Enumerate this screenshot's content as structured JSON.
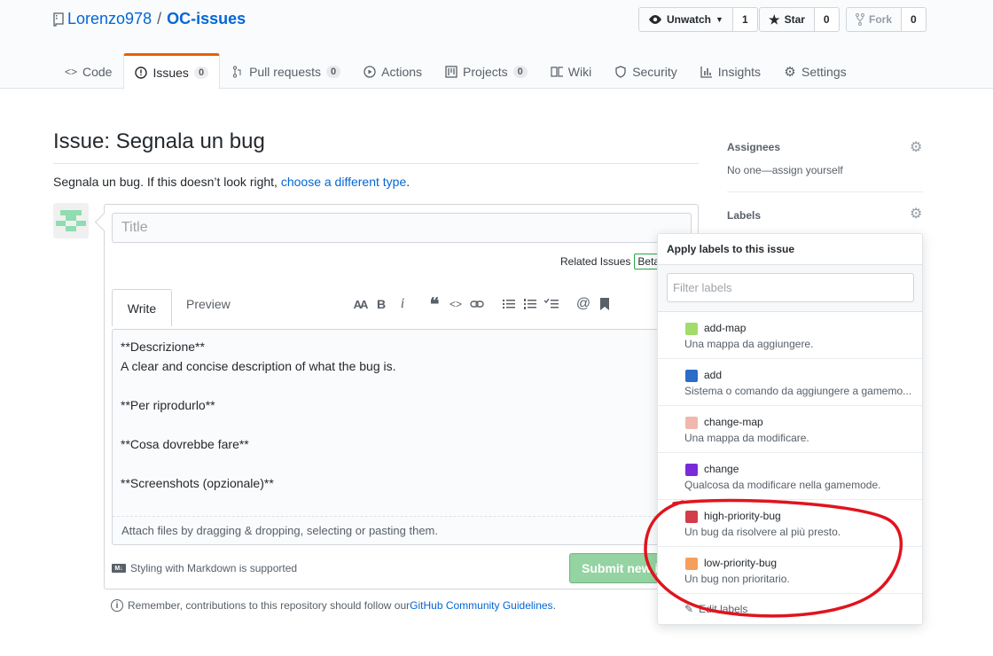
{
  "repo": {
    "owner": "Lorenzo978",
    "separator": "/",
    "name": "OC-issues",
    "watch_label": "Unwatch",
    "watch_count": "1",
    "star_label": "Star",
    "star_count": "0",
    "fork_label": "Fork",
    "fork_count": "0"
  },
  "tabs": [
    {
      "label": "Code",
      "icon": "code-icon"
    },
    {
      "label": "Issues",
      "icon": "issue-icon",
      "count": "0"
    },
    {
      "label": "Pull requests",
      "icon": "pull-request-icon",
      "count": "0"
    },
    {
      "label": "Actions",
      "icon": "play-icon"
    },
    {
      "label": "Projects",
      "icon": "project-icon",
      "count": "0"
    },
    {
      "label": "Wiki",
      "icon": "book-icon"
    },
    {
      "label": "Security",
      "icon": "shield-icon"
    },
    {
      "label": "Insights",
      "icon": "graph-icon"
    },
    {
      "label": "Settings",
      "icon": "gear-icon"
    }
  ],
  "issue": {
    "heading": "Issue: Segnala un bug",
    "subtitle_prefix": "Segnala un bug. If this doesn’t look right, ",
    "subtitle_link": "choose a different type",
    "subtitle_suffix": ".",
    "title_placeholder": "Title",
    "related_label": "Related Issues",
    "beta_label": "Beta",
    "write_tab": "Write",
    "preview_tab": "Preview",
    "toolbar_heading": "AA",
    "toolbar_bold": "B",
    "toolbar_italic": "i",
    "toolbar_mention": "@",
    "body": "**Descrizione**\nA clear and concise description of what the bug is.\n\n**Per riprodurlo**\n\n**Cosa dovrebbe fare**\n\n**Screenshots (opzionale)**",
    "attach_text": "Attach files by dragging & dropping, selecting or pasting them.",
    "markdown_note": "Styling with Markdown is supported",
    "submit_label": "Submit new i",
    "guidelines_prefix": "Remember, contributions to this repository should follow our ",
    "guidelines_link": "GitHub Community Guidelines",
    "guidelines_suffix": "."
  },
  "sidebar": {
    "assignees_heading": "Assignees",
    "assignees_value": "No one—assign yourself",
    "labels_heading": "Labels"
  },
  "labels_dropdown": {
    "heading": "Apply labels to this issue",
    "filter_placeholder": "Filter labels",
    "items": [
      {
        "name": "add-map",
        "description": "Una mappa da aggiungere.",
        "color": "#a2dc6b"
      },
      {
        "name": "add",
        "description": "Sistema o comando da aggiungere a gamemo...",
        "color": "#2a6cc7"
      },
      {
        "name": "change-map",
        "description": "Una mappa da modificare.",
        "color": "#f1b7ad"
      },
      {
        "name": "change",
        "description": "Qualcosa da modificare nella gamemode.",
        "color": "#7a2bd9"
      },
      {
        "name": "high-priority-bug",
        "description": "Un bug da risolvere al più presto.",
        "color": "#d43c4b"
      },
      {
        "name": "low-priority-bug",
        "description": "Un bug non prioritario.",
        "color": "#f59f5c"
      }
    ],
    "edit_label": "Edit labels"
  },
  "colors": {
    "annotation": "#e0141e",
    "link": "#0366d6",
    "tab_accent": "#e36209",
    "submit": "#94d3a2"
  }
}
